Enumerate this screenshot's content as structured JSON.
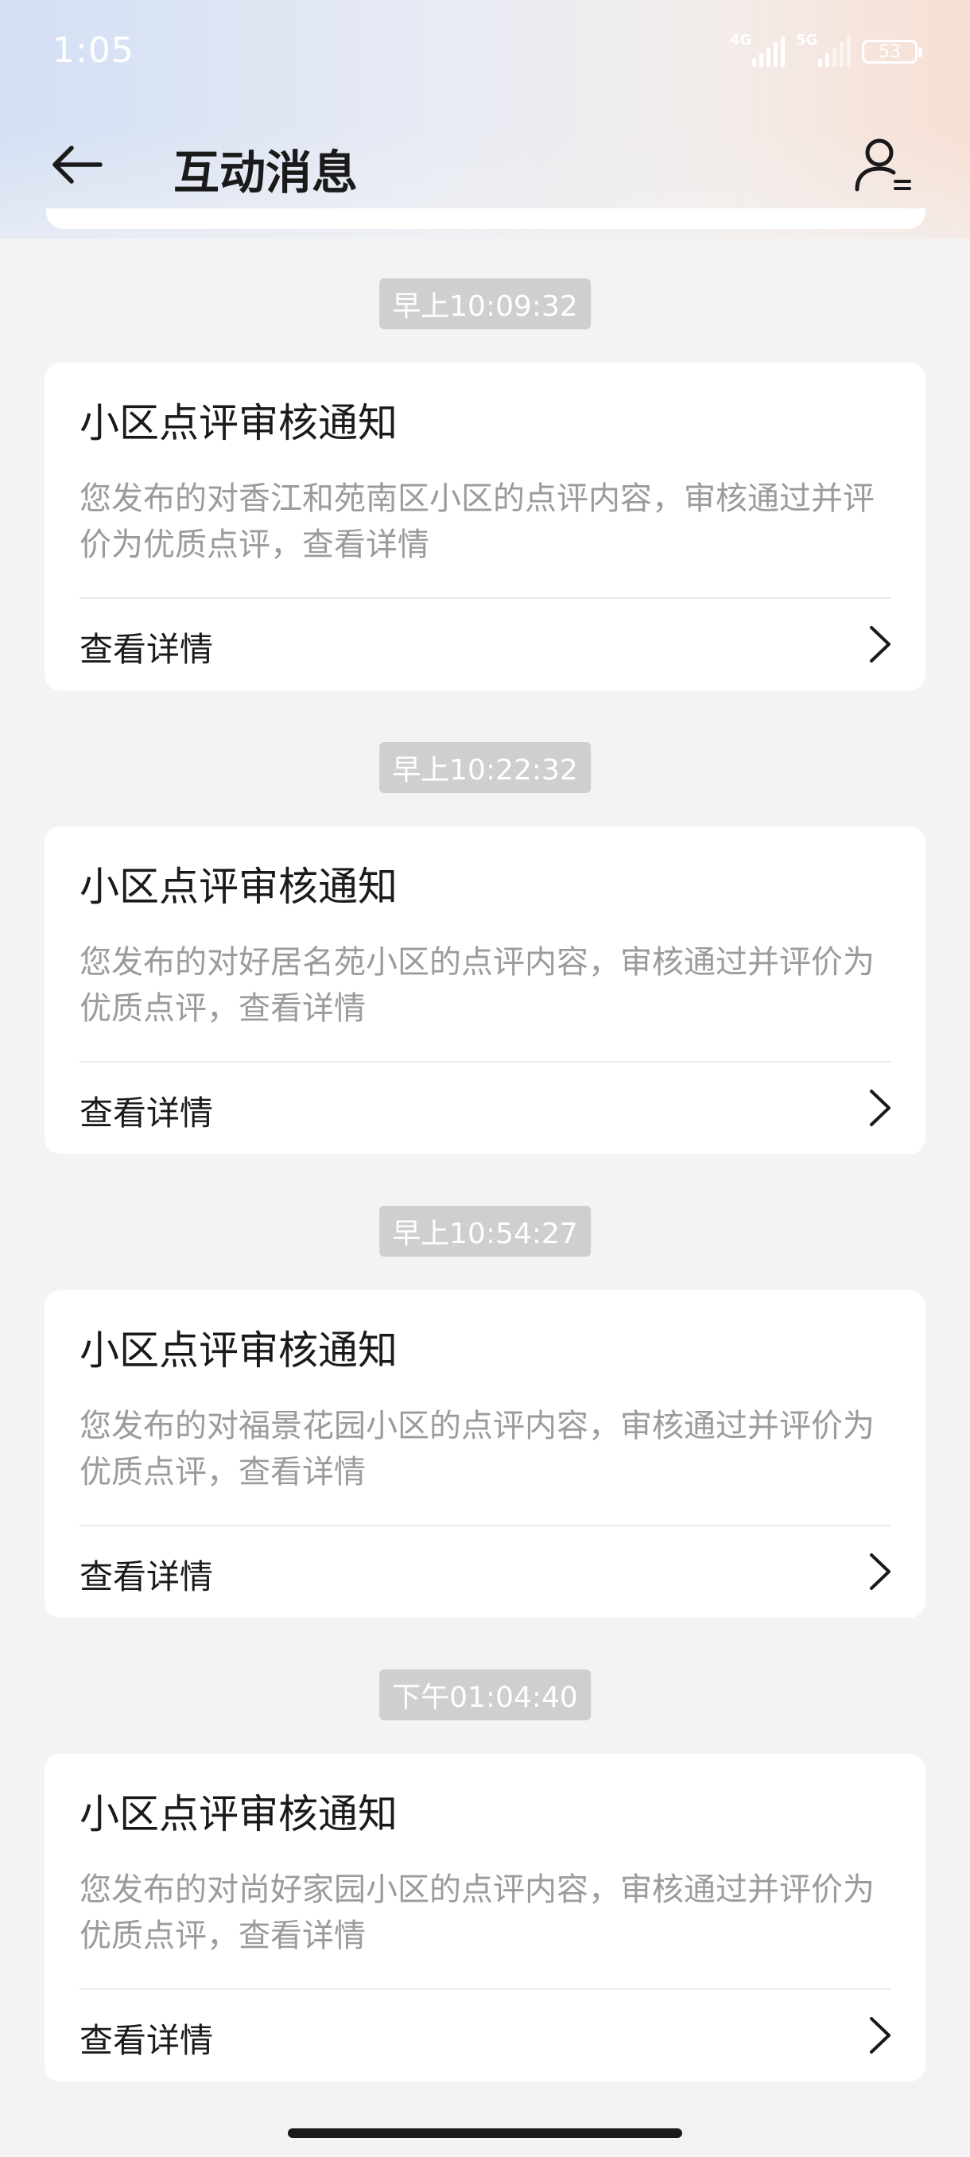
{
  "status_bar": {
    "time": "1:05",
    "network_1": "4G",
    "network_2": "5G",
    "battery": "53",
    "icons": [
      "signal-4g-icon",
      "signal-5g-icon",
      "battery-icon"
    ]
  },
  "header": {
    "title": "互动消息",
    "back_icon": "arrow-left-icon",
    "profile_icon": "user-settings-icon"
  },
  "messages": [
    {
      "time": "早上10:09:32",
      "title": "小区点评审核通知",
      "body": "您发布的对香江和苑南区小区的点评内容，审核通过并评价为优质点评，查看详情",
      "action": "查看详情"
    },
    {
      "time": "早上10:22:32",
      "title": "小区点评审核通知",
      "body": "您发布的对好居名苑小区的点评内容，审核通过并评价为优质点评，查看详情",
      "action": "查看详情"
    },
    {
      "time": "早上10:54:27",
      "title": "小区点评审核通知",
      "body": "您发布的对福景花园小区的点评内容，审核通过并评价为优质点评，查看详情",
      "action": "查看详情"
    },
    {
      "time": "下午01:04:40",
      "title": "小区点评审核通知",
      "body": "您发布的对尚好家园小区的点评内容，审核通过并评价为优质点评，查看详情",
      "action": "查看详情"
    }
  ],
  "colors": {
    "background": "#f3f3f3",
    "card": "#ffffff",
    "title_text": "#1a1a1a",
    "body_text": "#9b9b9b",
    "time_pill": "#cfcfcf"
  }
}
